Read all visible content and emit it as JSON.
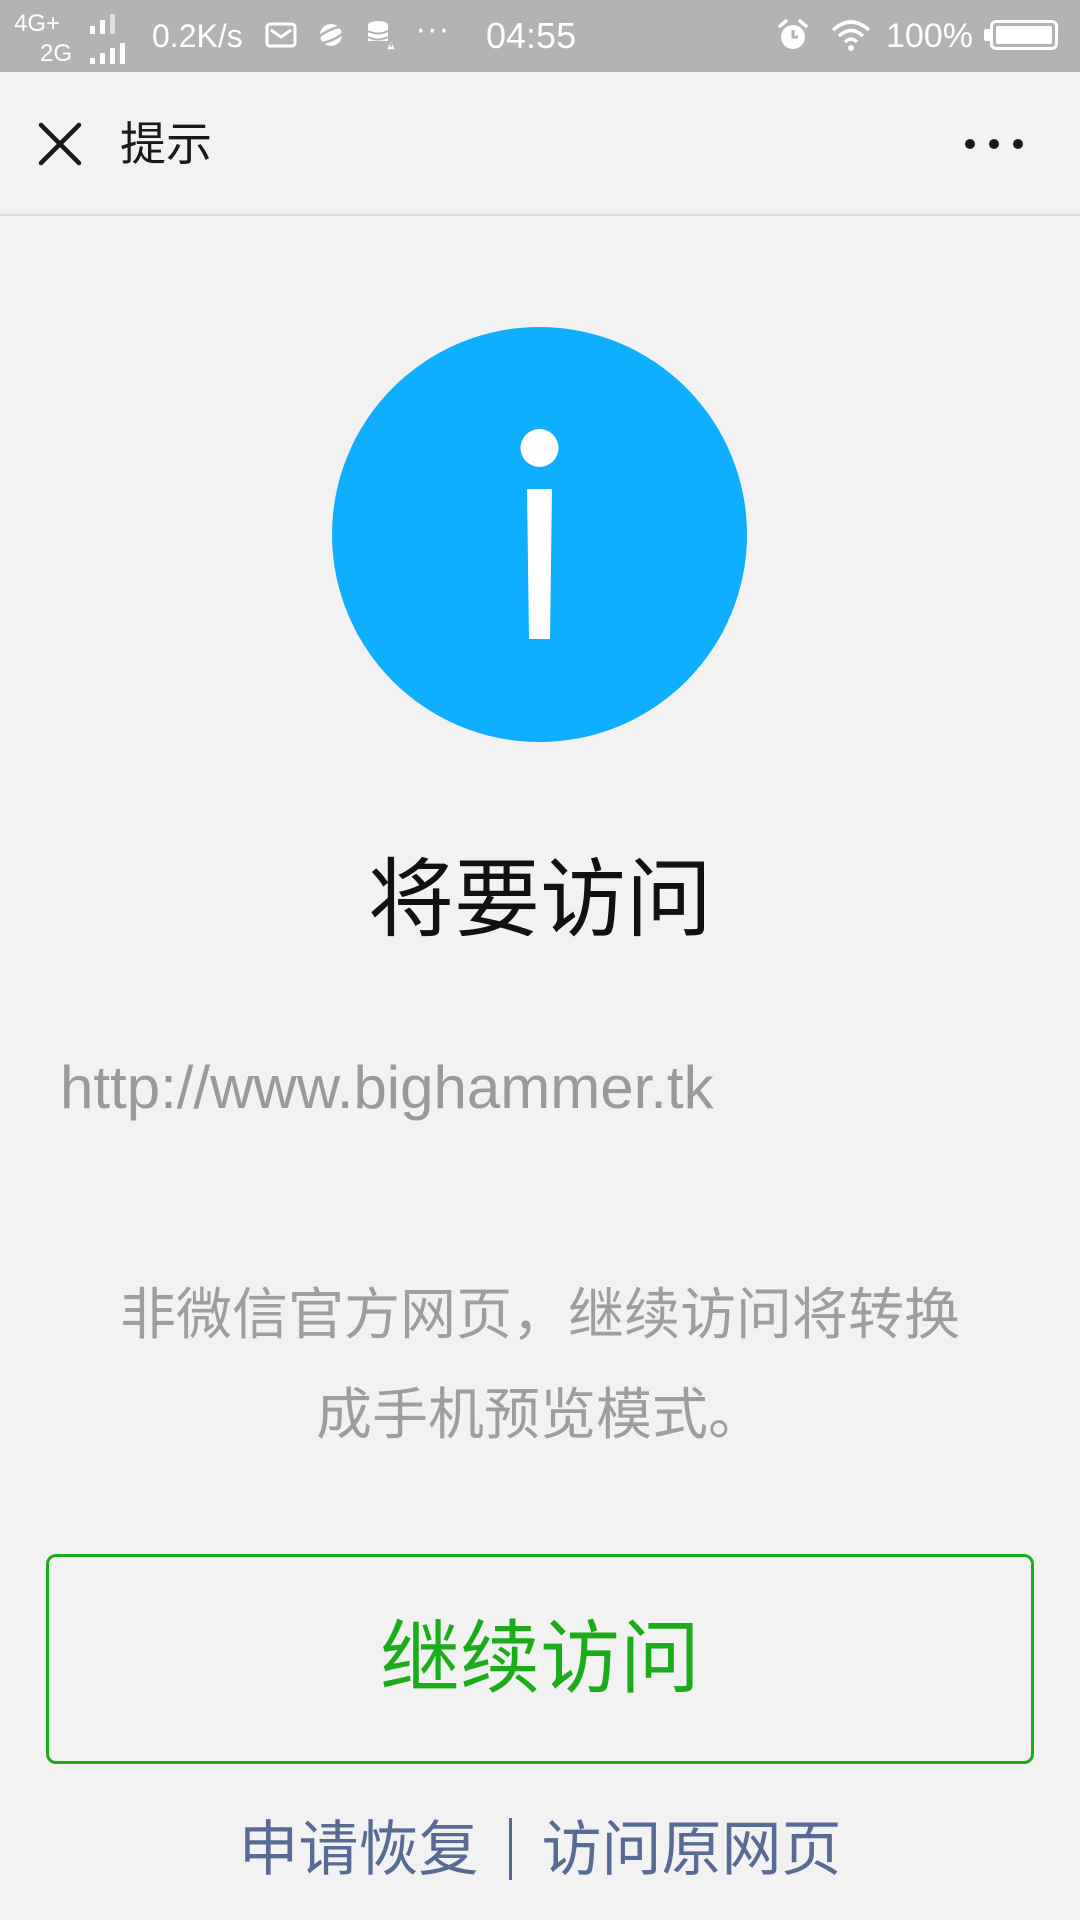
{
  "status_bar": {
    "network_primary": "4G+",
    "network_secondary": "2G",
    "speed": "0.2K/s",
    "time": "04:55",
    "battery_text": "100%",
    "battery_level": 1.0,
    "overflow": "···",
    "icons": [
      "mail-icon",
      "planet-icon",
      "database-warning-icon",
      "alarm-icon",
      "wifi-icon",
      "battery-icon"
    ]
  },
  "title_bar": {
    "title": "提示",
    "close_icon": "close-icon",
    "more_icon": "more-icon"
  },
  "main": {
    "icon": "info-icon",
    "icon_color": "#10aeff",
    "heading": "将要访问",
    "url": "http://www.bighammer.tk",
    "notice_line1": "非微信官方网页，继续访问将转换",
    "notice_line2": "成手机预览模式。",
    "continue_label": "继续访问",
    "accent_color": "#1aad19"
  },
  "footer": {
    "appeal_label": "申请恢复",
    "visit_original_label": "访问原网页",
    "link_color": "#576b95"
  }
}
